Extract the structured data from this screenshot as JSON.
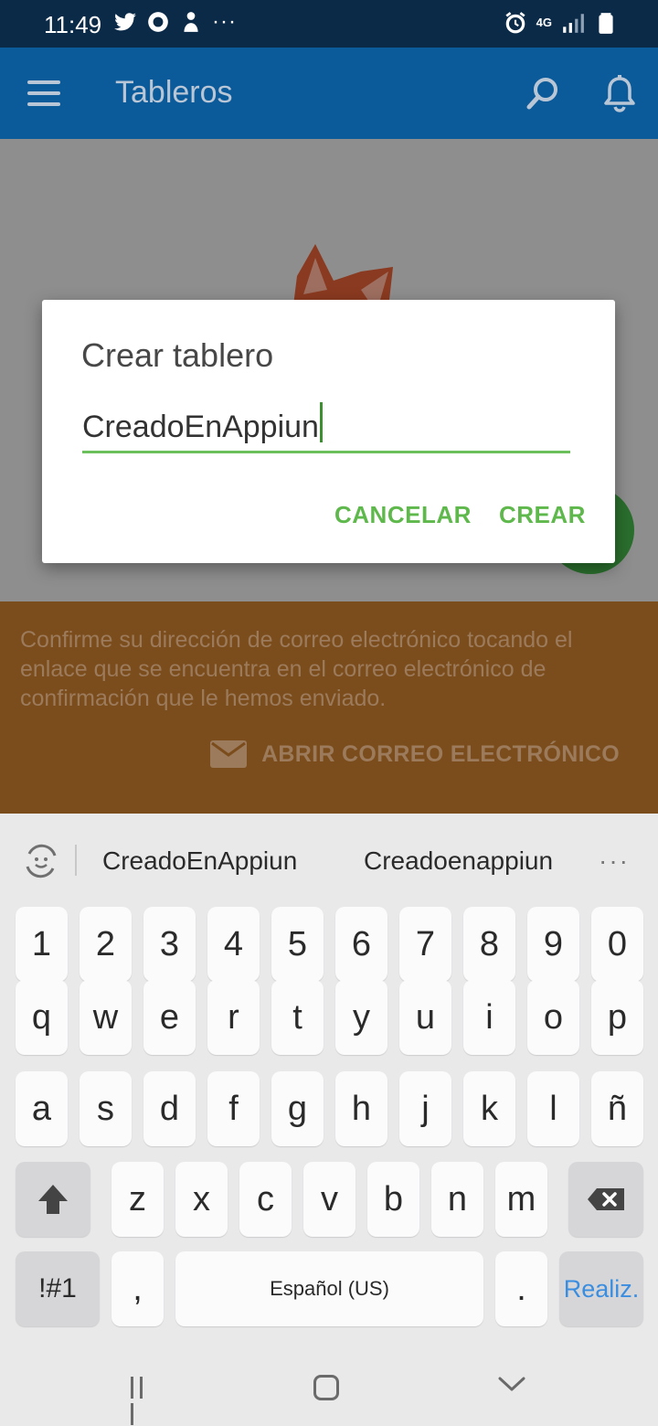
{
  "status_bar": {
    "time": "11:49",
    "left_icons": [
      "twitter-icon",
      "app-icon",
      "notification-icon",
      "more-icon"
    ],
    "right_icons": [
      "alarm-icon",
      "4g-icon",
      "signal-icon",
      "battery-icon"
    ],
    "network": "4G",
    "more": "···"
  },
  "app_bar": {
    "title": "Tableros",
    "icons": [
      "menu-icon",
      "search-icon",
      "bell-icon"
    ]
  },
  "dialog": {
    "title": "Crear tablero",
    "input_value": "CreadoEnAppiun",
    "cancel_label": "CANCELAR",
    "create_label": "CREAR",
    "accent_color": "#5eb84b"
  },
  "banner": {
    "text": "Confirme su dirección de correo electrónico tocando el enlace que se encuentra en el correo electrónico de confirmación que le hemos enviado.",
    "action_label": "ABRIR CORREO ELECTRÓNICO"
  },
  "keyboard": {
    "suggestions": [
      "CreadoEnAppiun",
      "Creadoenappiun"
    ],
    "more": "···",
    "row_numbers": [
      "1",
      "2",
      "3",
      "4",
      "5",
      "6",
      "7",
      "8",
      "9",
      "0"
    ],
    "row_1": [
      "q",
      "w",
      "e",
      "r",
      "t",
      "y",
      "u",
      "i",
      "o",
      "p"
    ],
    "row_2": [
      "a",
      "s",
      "d",
      "f",
      "g",
      "h",
      "j",
      "k",
      "l",
      "ñ"
    ],
    "row_3": [
      "z",
      "x",
      "c",
      "v",
      "b",
      "n",
      "m"
    ],
    "symbols_label": "!#1",
    "comma": ",",
    "space_label": "Español (US)",
    "period": ".",
    "done_label": "Realiz."
  },
  "colors": {
    "app_bar": "#0b5a9a",
    "status_bar": "#0a2a48",
    "banner": "#7b4d1c",
    "fab": "#2a6e2d"
  }
}
